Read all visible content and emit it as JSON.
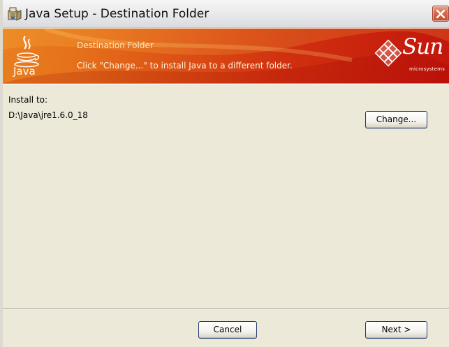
{
  "window": {
    "title": "Java Setup - Destination Folder"
  },
  "banner": {
    "heading": "Destination Folder",
    "subtitle": "Click \"Change...\" to install Java to a different folder.",
    "java_logo_text": "Java",
    "sun_logo_text": "Sun",
    "sun_logo_subtext": "microsystems"
  },
  "content": {
    "install_label": "Install to:",
    "install_path": "D:\\Java\\jre1.6.0_18",
    "change_button": "Change..."
  },
  "footer": {
    "cancel_button": "Cancel",
    "next_button": "Next >"
  },
  "colors": {
    "banner_orange": "#e97f1f",
    "banner_red": "#c2150c",
    "close_button_red": "#d9694d",
    "dialog_background": "#ece9d8"
  },
  "icons": {
    "title": "installer-package-icon",
    "close": "close-icon",
    "java": "java-coffee-cup-logo",
    "sun": "sun-microsystems-logo"
  }
}
